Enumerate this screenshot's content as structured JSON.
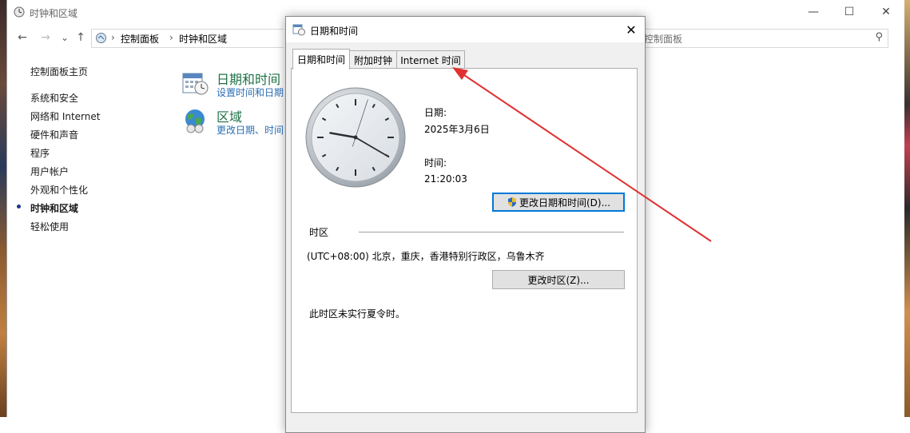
{
  "window": {
    "title": "时钟和区域",
    "minimize": "—",
    "maximize": "☐",
    "close": "✕"
  },
  "nav": {
    "back": "←",
    "forward": "→",
    "dropdown": "⌄",
    "up": "↑",
    "breadcrumb": [
      "控制面板",
      "时钟和区域"
    ],
    "search_placeholder": "搜索控制面板",
    "search_visible_text": "控制面板"
  },
  "sidebar": {
    "home": "控制面板主页",
    "items": [
      {
        "label": "系统和安全"
      },
      {
        "label": "网络和 Internet"
      },
      {
        "label": "硬件和声音"
      },
      {
        "label": "程序"
      },
      {
        "label": "用户帐户"
      },
      {
        "label": "外观和个性化"
      },
      {
        "label": "时钟和区域",
        "current": true
      },
      {
        "label": "轻松使用"
      }
    ]
  },
  "categories": [
    {
      "title": "日期和时间",
      "sub": "设置时间和日期",
      "icon": "calendar-clock-icon"
    },
    {
      "title": "区域",
      "sub": "更改日期、时间",
      "icon": "globe-icon"
    }
  ],
  "dialog": {
    "title": "日期和时间",
    "close": "✕",
    "tabs": [
      "日期和时间",
      "附加时钟",
      "Internet 时间"
    ],
    "selected_tab": 0,
    "date_label": "日期:",
    "date_value": "2025年3月6日",
    "time_label": "时间:",
    "time_value": "21:20:03",
    "change_datetime_button": "更改日期和时间(D)...",
    "timezone_header": "时区",
    "timezone_value": "(UTC+08:00) 北京，重庆，香港特别行政区，乌鲁木齐",
    "change_timezone_button": "更改时区(Z)...",
    "dst_note": "此时区未实行夏令时。"
  },
  "clock": {
    "hour": 21,
    "minute": 20,
    "second": 3
  },
  "colors": {
    "category_title": "#1e7145",
    "link": "#2b6fb6",
    "annotation_arrow": "#e03030",
    "focus_border": "#0078d7"
  }
}
